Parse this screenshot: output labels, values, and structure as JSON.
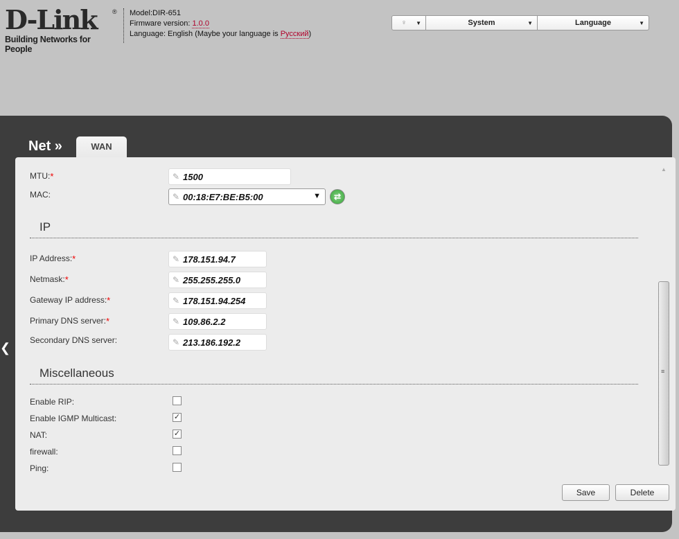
{
  "header": {
    "logo": "D-Link",
    "tagline": "Building Networks for People",
    "model": "Model:DIR-651",
    "firmware_label": "Firmware version: ",
    "firmware": "1.0.0",
    "language_text": "Language: English (Maybe your language is ",
    "language_suggest": "Русский",
    "language_close": ")"
  },
  "menu": {
    "system": "System",
    "language": "Language"
  },
  "page": {
    "title": "Net »",
    "tab": "WAN"
  },
  "fields": {
    "mtu_label": "MTU:",
    "mtu": "1500",
    "mac_label": "MAC:",
    "mac": "00:18:E7:BE:B5:00",
    "ip_section": "IP",
    "ip_label": "IP Address:",
    "ip": "178.151.94.7",
    "netmask_label": "Netmask:",
    "netmask": "255.255.255.0",
    "gateway_label": "Gateway IP address:",
    "gateway": "178.151.94.254",
    "dns1_label": "Primary DNS server:",
    "dns1": "109.86.2.2",
    "dns2_label": "Secondary DNS server:",
    "dns2": "213.186.192.2",
    "misc_section": "Miscellaneous",
    "rip_label": "Enable RIP:",
    "igmp_label": "Enable IGMP Multicast:",
    "nat_label": "NAT:",
    "firewall_label": "firewall:",
    "ping_label": "Ping:"
  },
  "checkboxes": {
    "rip": false,
    "igmp": true,
    "nat": true,
    "firewall": false,
    "ping": false
  },
  "buttons": {
    "save": "Save",
    "delete": "Delete"
  },
  "required": "*"
}
